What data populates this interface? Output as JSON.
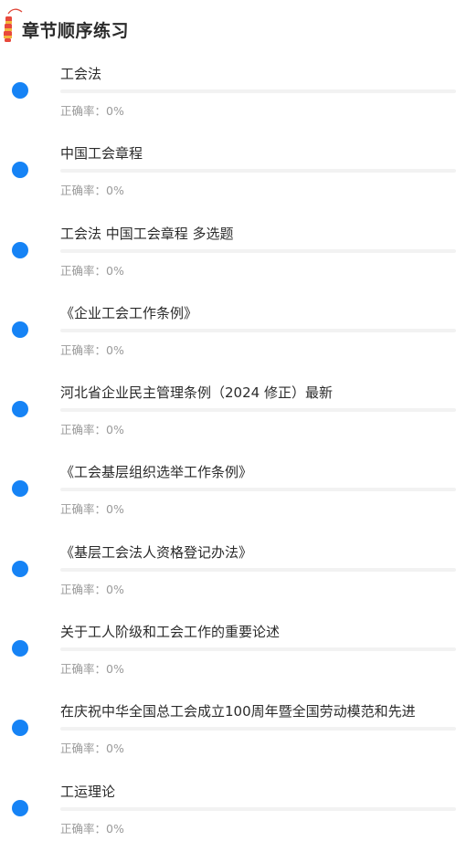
{
  "header": {
    "icon": "firecracker-icon",
    "title": "章节顺序练习"
  },
  "accuracy_label": "正确率：",
  "colors": {
    "accent": "#1683f5",
    "title": "#2a2a2a",
    "muted": "#9a9a9a",
    "track": "#f2f2f2"
  },
  "chapters": [
    {
      "name": "工会法",
      "accuracy": "0%",
      "progress": 0
    },
    {
      "name": "中国工会章程",
      "accuracy": "0%",
      "progress": 0
    },
    {
      "name": "工会法 中国工会章程 多选题",
      "accuracy": "0%",
      "progress": 0
    },
    {
      "name": "《企业工会工作条例》",
      "accuracy": "0%",
      "progress": 0
    },
    {
      "name": "河北省企业民主管理条例（2024 修正）最新",
      "accuracy": "0%",
      "progress": 0
    },
    {
      "name": "《工会基层组织选举工作条例》",
      "accuracy": "0%",
      "progress": 0
    },
    {
      "name": "《基层工会法人资格登记办法》",
      "accuracy": "0%",
      "progress": 0
    },
    {
      "name": "关于工人阶级和工会工作的重要论述",
      "accuracy": "0%",
      "progress": 0
    },
    {
      "name": "在庆祝中华全国总工会成立100周年暨全国劳动模范和先进",
      "accuracy": "0%",
      "progress": 0
    },
    {
      "name": "工运理论",
      "accuracy": "0%",
      "progress": 0
    }
  ]
}
